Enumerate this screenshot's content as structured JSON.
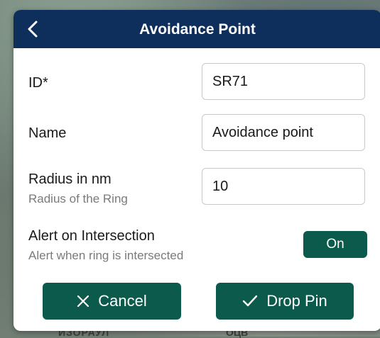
{
  "header": {
    "title": "Avoidance Point"
  },
  "form": {
    "id": {
      "label": "ID*",
      "value": "SR71"
    },
    "name": {
      "label": "Name",
      "value": "Avoidance point"
    },
    "radius": {
      "label": "Radius in nm",
      "sublabel": "Radius of the Ring",
      "value": "10"
    },
    "alert": {
      "label": "Alert on Intersection",
      "sublabel": "Alert when ring is intersected",
      "toggle_label": "On"
    }
  },
  "actions": {
    "cancel_label": "Cancel",
    "drop_label": "Drop Pin"
  },
  "map": {
    "label_left": "ИЗОРАУЛ",
    "label_right": "ОЦВ"
  },
  "colors": {
    "header": "#0e2f5c",
    "accent": "#0b5a4b"
  },
  "icons": {
    "back": "chevron-left-icon",
    "cancel": "close-icon",
    "drop": "check-icon"
  }
}
